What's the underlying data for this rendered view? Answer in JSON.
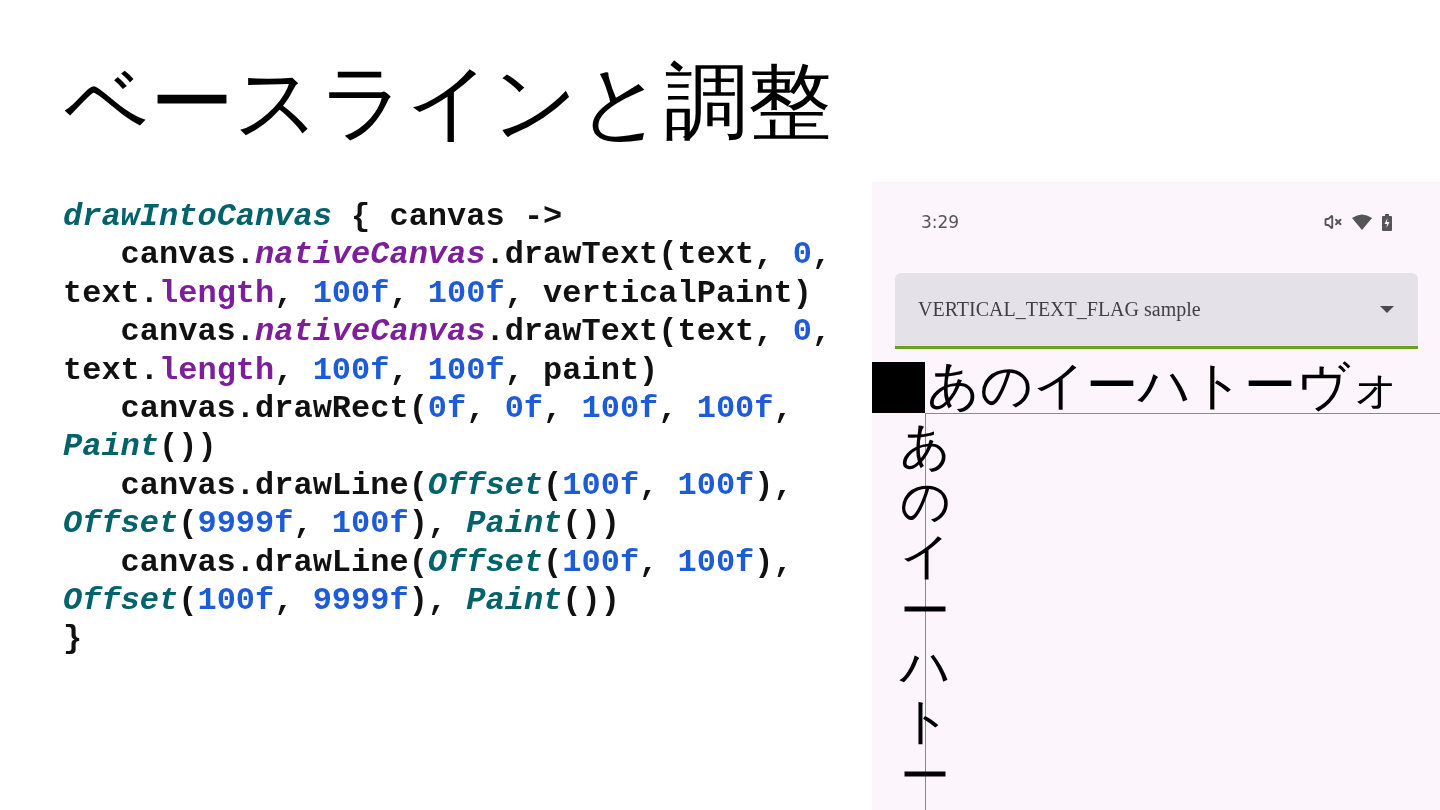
{
  "slide": {
    "title": "ベースラインと調整"
  },
  "code": {
    "lines": [
      {
        "indent": false,
        "tokens": [
          {
            "kind": "function",
            "text": "drawIntoCanvas"
          },
          {
            "kind": "plain",
            "text": " { canvas ->"
          }
        ]
      },
      {
        "indent": true,
        "tokens": [
          {
            "kind": "plain",
            "text": "canvas."
          },
          {
            "kind": "property",
            "text": "nativeCanvas"
          },
          {
            "kind": "plain",
            "text": ".drawText(text, "
          },
          {
            "kind": "number",
            "text": "0"
          },
          {
            "kind": "plain",
            "text": ","
          }
        ]
      },
      {
        "indent": false,
        "tokens": [
          {
            "kind": "plain",
            "text": "text."
          },
          {
            "kind": "member",
            "text": "length"
          },
          {
            "kind": "plain",
            "text": ", "
          },
          {
            "kind": "number",
            "text": "100f"
          },
          {
            "kind": "plain",
            "text": ", "
          },
          {
            "kind": "number",
            "text": "100f"
          },
          {
            "kind": "plain",
            "text": ", verticalPaint)"
          }
        ]
      },
      {
        "indent": true,
        "tokens": [
          {
            "kind": "plain",
            "text": "canvas."
          },
          {
            "kind": "property",
            "text": "nativeCanvas"
          },
          {
            "kind": "plain",
            "text": ".drawText(text, "
          },
          {
            "kind": "number",
            "text": "0"
          },
          {
            "kind": "plain",
            "text": ","
          }
        ]
      },
      {
        "indent": false,
        "tokens": [
          {
            "kind": "plain",
            "text": "text."
          },
          {
            "kind": "member",
            "text": "length"
          },
          {
            "kind": "plain",
            "text": ", "
          },
          {
            "kind": "number",
            "text": "100f"
          },
          {
            "kind": "plain",
            "text": ", "
          },
          {
            "kind": "number",
            "text": "100f"
          },
          {
            "kind": "plain",
            "text": ", paint)"
          }
        ]
      },
      {
        "indent": true,
        "tokens": [
          {
            "kind": "plain",
            "text": "canvas.drawRect("
          },
          {
            "kind": "number",
            "text": "0f"
          },
          {
            "kind": "plain",
            "text": ", "
          },
          {
            "kind": "number",
            "text": "0f"
          },
          {
            "kind": "plain",
            "text": ", "
          },
          {
            "kind": "number",
            "text": "100f"
          },
          {
            "kind": "plain",
            "text": ", "
          },
          {
            "kind": "number",
            "text": "100f"
          },
          {
            "kind": "plain",
            "text": ","
          }
        ]
      },
      {
        "indent": false,
        "tokens": [
          {
            "kind": "function",
            "text": "Paint"
          },
          {
            "kind": "plain",
            "text": "())"
          }
        ]
      },
      {
        "indent": true,
        "tokens": [
          {
            "kind": "plain",
            "text": "canvas.drawLine("
          },
          {
            "kind": "function",
            "text": "Offset"
          },
          {
            "kind": "plain",
            "text": "("
          },
          {
            "kind": "number",
            "text": "100f"
          },
          {
            "kind": "plain",
            "text": ", "
          },
          {
            "kind": "number",
            "text": "100f"
          },
          {
            "kind": "plain",
            "text": "),"
          }
        ]
      },
      {
        "indent": false,
        "tokens": [
          {
            "kind": "function",
            "text": "Offset"
          },
          {
            "kind": "plain",
            "text": "("
          },
          {
            "kind": "number",
            "text": "9999f"
          },
          {
            "kind": "plain",
            "text": ", "
          },
          {
            "kind": "number",
            "text": "100f"
          },
          {
            "kind": "plain",
            "text": "), "
          },
          {
            "kind": "function",
            "text": "Paint"
          },
          {
            "kind": "plain",
            "text": "())"
          }
        ]
      },
      {
        "indent": true,
        "tokens": [
          {
            "kind": "plain",
            "text": "canvas.drawLine("
          },
          {
            "kind": "function",
            "text": "Offset"
          },
          {
            "kind": "plain",
            "text": "("
          },
          {
            "kind": "number",
            "text": "100f"
          },
          {
            "kind": "plain",
            "text": ", "
          },
          {
            "kind": "number",
            "text": "100f"
          },
          {
            "kind": "plain",
            "text": "),"
          }
        ]
      },
      {
        "indent": false,
        "tokens": [
          {
            "kind": "function",
            "text": "Offset"
          },
          {
            "kind": "plain",
            "text": "("
          },
          {
            "kind": "number",
            "text": "100f"
          },
          {
            "kind": "plain",
            "text": ", "
          },
          {
            "kind": "number",
            "text": "9999f"
          },
          {
            "kind": "plain",
            "text": "), "
          },
          {
            "kind": "function",
            "text": "Paint"
          },
          {
            "kind": "plain",
            "text": "())"
          }
        ]
      },
      {
        "indent": false,
        "tokens": [
          {
            "kind": "plain",
            "text": "}"
          }
        ]
      }
    ]
  },
  "phone": {
    "status_bar": {
      "time": "3:29"
    },
    "dropdown": {
      "value": "VERTICAL_TEXT_FLAG sample"
    },
    "canvas": {
      "horizontal_text": "あのイーハトーヴォ",
      "vertical_text": "あのイーハトー"
    }
  }
}
